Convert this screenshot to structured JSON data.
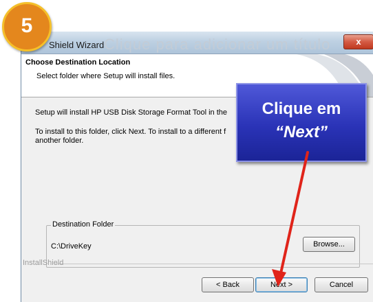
{
  "window": {
    "title": "Shield Wizard",
    "background_text": "Clique para adicionar um título",
    "close_label": "x"
  },
  "header": {
    "title": "Choose Destination Location",
    "subtitle": "Select folder where Setup will install files."
  },
  "body": {
    "line1": "Setup will install HP USB Disk Storage Format Tool in the",
    "line2": "To install to this folder, click Next. To install to a different f",
    "line3": "another folder."
  },
  "destination": {
    "legend": "Destination Folder",
    "path": "C:\\DriveKey",
    "browse_label": "Browse..."
  },
  "footer": {
    "brand": "InstallShield",
    "back_label": "< Back",
    "next_label": "Next >",
    "cancel_label": "Cancel"
  },
  "annotation": {
    "step_number": "5",
    "callout_line1": "Clique em",
    "callout_line2": "“Next”"
  },
  "colors": {
    "callout": "#2a33b7",
    "arrow": "#e0241a",
    "badge": "#e4871d",
    "badge_ring": "#f5c02a"
  }
}
